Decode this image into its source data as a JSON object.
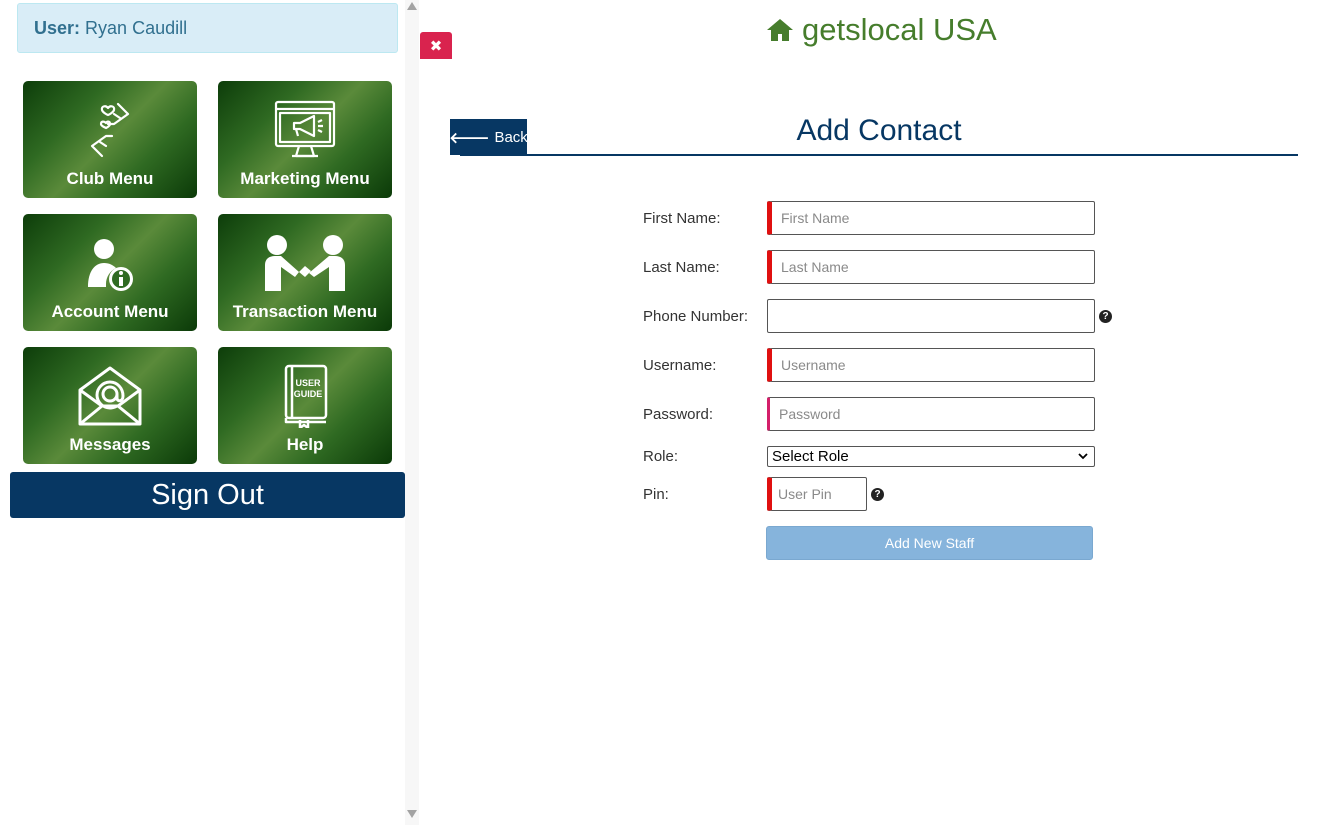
{
  "sidebar": {
    "user_label": "User:",
    "user_name": "Ryan Caudill",
    "tiles": [
      {
        "label": "Club Menu",
        "icon": "hands-heart-icon"
      },
      {
        "label": "Marketing Menu",
        "icon": "megaphone-monitor-icon"
      },
      {
        "label": "Account Menu",
        "icon": "user-info-icon"
      },
      {
        "label": "Transaction Menu",
        "icon": "handshake-icon"
      },
      {
        "label": "Messages",
        "icon": "envelope-at-icon"
      },
      {
        "label": "Help",
        "icon": "user-guide-icon"
      }
    ],
    "user_guide_text_1": "USER",
    "user_guide_text_2": "GUIDE",
    "signout_label": "Sign Out",
    "close_symbol": "✖"
  },
  "header": {
    "brand": "getslocal USA"
  },
  "main": {
    "back_label": "Back",
    "title": "Add Contact",
    "form": {
      "first_name_label": "First Name:",
      "first_name_placeholder": "First Name",
      "last_name_label": "Last Name:",
      "last_name_placeholder": "Last Name",
      "phone_label": "Phone Number:",
      "phone_value": "",
      "username_label": "Username:",
      "username_placeholder": "Username",
      "password_label": "Password:",
      "password_placeholder": "Password",
      "role_label": "Role:",
      "role_selected": "Select Role",
      "pin_label": "Pin:",
      "pin_placeholder": "User Pin",
      "help_symbol": "?",
      "submit_label": "Add New Staff"
    }
  },
  "colors": {
    "brand_green": "#467d2c",
    "navy": "#073763",
    "required_red": "#e01010",
    "close_red": "#d9234e",
    "submit_blue": "#86b4dc"
  }
}
